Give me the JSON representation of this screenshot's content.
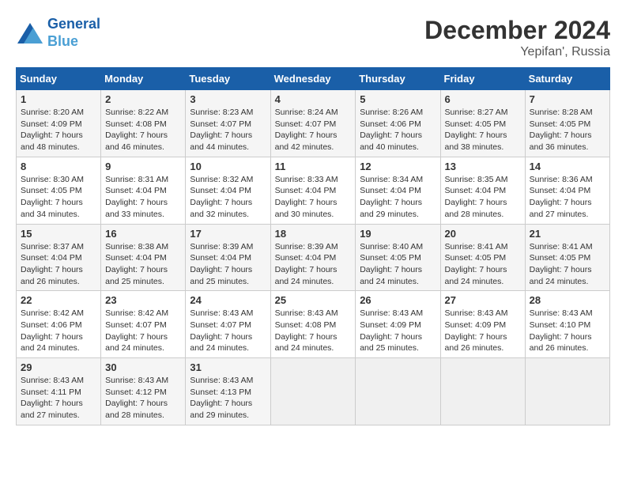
{
  "header": {
    "logo_line1": "General",
    "logo_line2": "Blue",
    "title": "December 2024",
    "subtitle": "Yepifan', Russia"
  },
  "days_of_week": [
    "Sunday",
    "Monday",
    "Tuesday",
    "Wednesday",
    "Thursday",
    "Friday",
    "Saturday"
  ],
  "weeks": [
    [
      {
        "day": "1",
        "sunrise": "Sunrise: 8:20 AM",
        "sunset": "Sunset: 4:09 PM",
        "daylight": "Daylight: 7 hours and 48 minutes."
      },
      {
        "day": "2",
        "sunrise": "Sunrise: 8:22 AM",
        "sunset": "Sunset: 4:08 PM",
        "daylight": "Daylight: 7 hours and 46 minutes."
      },
      {
        "day": "3",
        "sunrise": "Sunrise: 8:23 AM",
        "sunset": "Sunset: 4:07 PM",
        "daylight": "Daylight: 7 hours and 44 minutes."
      },
      {
        "day": "4",
        "sunrise": "Sunrise: 8:24 AM",
        "sunset": "Sunset: 4:07 PM",
        "daylight": "Daylight: 7 hours and 42 minutes."
      },
      {
        "day": "5",
        "sunrise": "Sunrise: 8:26 AM",
        "sunset": "Sunset: 4:06 PM",
        "daylight": "Daylight: 7 hours and 40 minutes."
      },
      {
        "day": "6",
        "sunrise": "Sunrise: 8:27 AM",
        "sunset": "Sunset: 4:05 PM",
        "daylight": "Daylight: 7 hours and 38 minutes."
      },
      {
        "day": "7",
        "sunrise": "Sunrise: 8:28 AM",
        "sunset": "Sunset: 4:05 PM",
        "daylight": "Daylight: 7 hours and 36 minutes."
      }
    ],
    [
      {
        "day": "8",
        "sunrise": "Sunrise: 8:30 AM",
        "sunset": "Sunset: 4:05 PM",
        "daylight": "Daylight: 7 hours and 34 minutes."
      },
      {
        "day": "9",
        "sunrise": "Sunrise: 8:31 AM",
        "sunset": "Sunset: 4:04 PM",
        "daylight": "Daylight: 7 hours and 33 minutes."
      },
      {
        "day": "10",
        "sunrise": "Sunrise: 8:32 AM",
        "sunset": "Sunset: 4:04 PM",
        "daylight": "Daylight: 7 hours and 32 minutes."
      },
      {
        "day": "11",
        "sunrise": "Sunrise: 8:33 AM",
        "sunset": "Sunset: 4:04 PM",
        "daylight": "Daylight: 7 hours and 30 minutes."
      },
      {
        "day": "12",
        "sunrise": "Sunrise: 8:34 AM",
        "sunset": "Sunset: 4:04 PM",
        "daylight": "Daylight: 7 hours and 29 minutes."
      },
      {
        "day": "13",
        "sunrise": "Sunrise: 8:35 AM",
        "sunset": "Sunset: 4:04 PM",
        "daylight": "Daylight: 7 hours and 28 minutes."
      },
      {
        "day": "14",
        "sunrise": "Sunrise: 8:36 AM",
        "sunset": "Sunset: 4:04 PM",
        "daylight": "Daylight: 7 hours and 27 minutes."
      }
    ],
    [
      {
        "day": "15",
        "sunrise": "Sunrise: 8:37 AM",
        "sunset": "Sunset: 4:04 PM",
        "daylight": "Daylight: 7 hours and 26 minutes."
      },
      {
        "day": "16",
        "sunrise": "Sunrise: 8:38 AM",
        "sunset": "Sunset: 4:04 PM",
        "daylight": "Daylight: 7 hours and 25 minutes."
      },
      {
        "day": "17",
        "sunrise": "Sunrise: 8:39 AM",
        "sunset": "Sunset: 4:04 PM",
        "daylight": "Daylight: 7 hours and 25 minutes."
      },
      {
        "day": "18",
        "sunrise": "Sunrise: 8:39 AM",
        "sunset": "Sunset: 4:04 PM",
        "daylight": "Daylight: 7 hours and 24 minutes."
      },
      {
        "day": "19",
        "sunrise": "Sunrise: 8:40 AM",
        "sunset": "Sunset: 4:05 PM",
        "daylight": "Daylight: 7 hours and 24 minutes."
      },
      {
        "day": "20",
        "sunrise": "Sunrise: 8:41 AM",
        "sunset": "Sunset: 4:05 PM",
        "daylight": "Daylight: 7 hours and 24 minutes."
      },
      {
        "day": "21",
        "sunrise": "Sunrise: 8:41 AM",
        "sunset": "Sunset: 4:05 PM",
        "daylight": "Daylight: 7 hours and 24 minutes."
      }
    ],
    [
      {
        "day": "22",
        "sunrise": "Sunrise: 8:42 AM",
        "sunset": "Sunset: 4:06 PM",
        "daylight": "Daylight: 7 hours and 24 minutes."
      },
      {
        "day": "23",
        "sunrise": "Sunrise: 8:42 AM",
        "sunset": "Sunset: 4:07 PM",
        "daylight": "Daylight: 7 hours and 24 minutes."
      },
      {
        "day": "24",
        "sunrise": "Sunrise: 8:43 AM",
        "sunset": "Sunset: 4:07 PM",
        "daylight": "Daylight: 7 hours and 24 minutes."
      },
      {
        "day": "25",
        "sunrise": "Sunrise: 8:43 AM",
        "sunset": "Sunset: 4:08 PM",
        "daylight": "Daylight: 7 hours and 24 minutes."
      },
      {
        "day": "26",
        "sunrise": "Sunrise: 8:43 AM",
        "sunset": "Sunset: 4:09 PM",
        "daylight": "Daylight: 7 hours and 25 minutes."
      },
      {
        "day": "27",
        "sunrise": "Sunrise: 8:43 AM",
        "sunset": "Sunset: 4:09 PM",
        "daylight": "Daylight: 7 hours and 26 minutes."
      },
      {
        "day": "28",
        "sunrise": "Sunrise: 8:43 AM",
        "sunset": "Sunset: 4:10 PM",
        "daylight": "Daylight: 7 hours and 26 minutes."
      }
    ],
    [
      {
        "day": "29",
        "sunrise": "Sunrise: 8:43 AM",
        "sunset": "Sunset: 4:11 PM",
        "daylight": "Daylight: 7 hours and 27 minutes."
      },
      {
        "day": "30",
        "sunrise": "Sunrise: 8:43 AM",
        "sunset": "Sunset: 4:12 PM",
        "daylight": "Daylight: 7 hours and 28 minutes."
      },
      {
        "day": "31",
        "sunrise": "Sunrise: 8:43 AM",
        "sunset": "Sunset: 4:13 PM",
        "daylight": "Daylight: 7 hours and 29 minutes."
      },
      null,
      null,
      null,
      null
    ]
  ]
}
